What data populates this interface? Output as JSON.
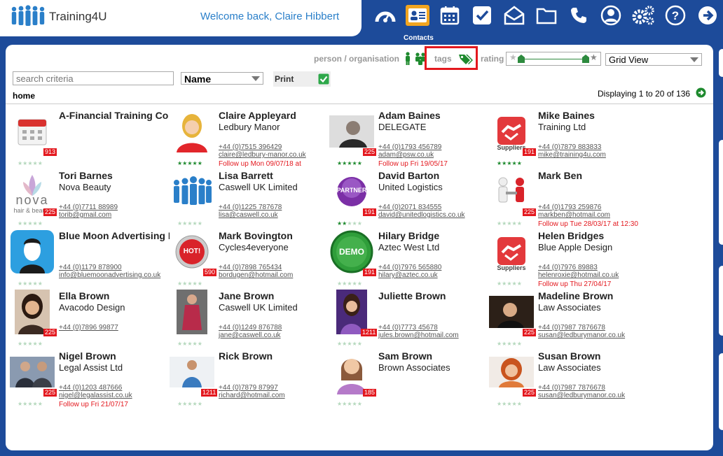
{
  "header": {
    "app_name": "Training4U",
    "welcome": "Welcome back, Claire Hibbert",
    "active_label": "Contacts"
  },
  "nav": [
    {
      "icon": "dashboard-icon",
      "active": false
    },
    {
      "icon": "contacts-icon",
      "active": true
    },
    {
      "icon": "calendar-icon",
      "active": false
    },
    {
      "icon": "tasks-check-icon",
      "active": false
    },
    {
      "icon": "mail-icon",
      "active": false
    },
    {
      "icon": "folder-icon",
      "active": false
    },
    {
      "icon": "phone-icon",
      "active": false
    },
    {
      "icon": "user-icon",
      "active": false
    },
    {
      "icon": "settings-icon",
      "active": false
    },
    {
      "icon": "help-icon",
      "active": false
    },
    {
      "icon": "logout-icon",
      "active": false
    }
  ],
  "toolbar": {
    "person_org_label": "person / organisation",
    "tags_label": "tags",
    "rating_label": "rating",
    "view_select": "Grid View",
    "search_placeholder": "search criteria",
    "sort_select": "Name",
    "print_label": "Print",
    "home_label": "home",
    "displaying": "Displaying 1 to 20 of 136"
  },
  "contacts": [
    {
      "name": "A-Financial Training Co",
      "org": "",
      "phone": "",
      "email": "",
      "followup": "",
      "badge": "913",
      "thumb": "calendar",
      "stars": 0
    },
    {
      "name": "Claire Appleyard",
      "org": "Ledbury Manor",
      "phone": "+44 (0)7515 396429",
      "email": "claire@ledbury-manor.co.uk",
      "followup": "Follow up Mon 09/07/18 at",
      "badge": "",
      "thumb": "woman-red",
      "stars": 5
    },
    {
      "name": "Adam Baines",
      "org": "DELEGATE",
      "phone": "+44 (0)1793 456789",
      "email": "adam@psw.co.uk",
      "followup": "Follow up Fri 19/05/17",
      "badge": "225",
      "thumb": "man-phone",
      "stars": 5
    },
    {
      "name": "Mike Baines",
      "org": "Training Ltd",
      "phone": "+44 (0)7879 883833",
      "email": "mike@training4u.com",
      "followup": "",
      "badge": "191",
      "thumb": "suppliers",
      "thumb_text": "Suppliers",
      "stars": 5
    },
    {
      "name": "Tori Barnes",
      "org": "Nova Beauty",
      "phone": "+44 (0)7711 88989",
      "email": "torib@gmail.com",
      "followup": "",
      "badge": "225",
      "thumb": "nova",
      "thumb_text": "nova",
      "thumb_sub": "hair & beauty",
      "stars": 0
    },
    {
      "name": "Lisa Barrett",
      "org": "Caswell UK Limited",
      "phone": "+44 (0)1225 787678",
      "email": "lisa@caswell.co.uk",
      "followup": "",
      "badge": "",
      "thumb": "people",
      "stars": 0
    },
    {
      "name": "David Barton",
      "org": "United Logistics",
      "phone": "+44 (0)2071 834555",
      "email": "david@unitedlogistics.co.uk",
      "followup": "",
      "badge": "191",
      "thumb": "partner",
      "thumb_text": "PARTNER",
      "stars": 2
    },
    {
      "name": "Mark Ben",
      "org": "",
      "phone": "+44 (0)1793 259876",
      "email": "markben@hotmail.com",
      "followup": "Follow up Tue 28/03/17 at 12:30",
      "badge": "225",
      "thumb": "handshake-figures",
      "stars": 0
    },
    {
      "name": "Blue Moon Advertising L",
      "org": "",
      "phone": "+44 (0)1179 878900",
      "email": "info@bluemoonadvertising.co.uk",
      "followup": "",
      "badge": "",
      "thumb": "avatar-blue",
      "stars": 0
    },
    {
      "name": "Mark Bovington",
      "org": "Cycles4everyone",
      "phone": "+44 (0)7898 765434",
      "email": "bordugen@hotmail.com",
      "followup": "",
      "badge": "590",
      "thumb": "hot",
      "thumb_text": "HOT!",
      "stars": 0
    },
    {
      "name": "Hilary Bridge",
      "org": "Aztec West Ltd",
      "phone": "+44 (0)7976 565880",
      "email": "hilary@aztec.co.uk",
      "followup": "",
      "badge": "191",
      "thumb": "demo",
      "thumb_text": "DEMO",
      "stars": 0
    },
    {
      "name": "Helen Bridges",
      "org": "Blue Apple Design",
      "phone": "+44 (0)7976 89883",
      "email": "helenroxie@hotmail.co.uk",
      "followup": "Follow up Thu 27/04/17",
      "badge": "",
      "thumb": "suppliers",
      "thumb_text": "Suppliers",
      "stars": 0
    },
    {
      "name": "Ella Brown",
      "org": "Avacodo Design",
      "phone": "+44 (0)7896 99877",
      "email": "",
      "followup": "",
      "badge": "225",
      "thumb": "woman-dark",
      "stars": 0
    },
    {
      "name": "Jane Brown",
      "org": "Caswell UK Limited",
      "phone": "+44 (0)1249 876788",
      "email": "jane@caswell.co.uk",
      "followup": "",
      "badge": "",
      "thumb": "woman-street",
      "stars": 0
    },
    {
      "name": "Juliette Brown",
      "org": "",
      "phone": "+44 (0)7773 45678",
      "email": "jules.brown@hotmail.com",
      "followup": "",
      "badge": "1211",
      "thumb": "woman-purple",
      "stars": 0
    },
    {
      "name": "Madeline Brown",
      "org": "Law Associates",
      "phone": "+44 (0)7987 7876678",
      "email": "susan@ledburymanor.co.uk",
      "followup": "",
      "badge": "225",
      "thumb": "woman-dark2",
      "stars": 0
    },
    {
      "name": "Nigel Brown",
      "org": "Legal Assist Ltd",
      "phone": "+44 (0)1203 487666",
      "email": "nigel@legalassist.co.uk",
      "followup": "Follow up Fri 21/07/17",
      "badge": "225",
      "thumb": "man-suit",
      "stars": 0
    },
    {
      "name": "Rick Brown",
      "org": "",
      "phone": "+44 (0)7879 87997",
      "email": "richard@hotmail.com",
      "followup": "",
      "badge": "1211",
      "thumb": "man-casual",
      "stars": 0
    },
    {
      "name": "Sam Brown",
      "org": "Brown Associates",
      "phone": "",
      "email": "",
      "followup": "",
      "badge": "185",
      "thumb": "avatar-woman",
      "stars": 0
    },
    {
      "name": "Susan Brown",
      "org": "Law Associates",
      "phone": "+44 (0)7987 7876678",
      "email": "susan@ledburymanor.co.uk",
      "followup": "",
      "badge": "225",
      "thumb": "woman-red-hair",
      "stars": 0
    }
  ],
  "colors": {
    "brand_blue": "#1d4b9a",
    "accent_orange": "#f2a520",
    "alert_red": "#e3181e",
    "star_green": "#1e8a2e"
  }
}
